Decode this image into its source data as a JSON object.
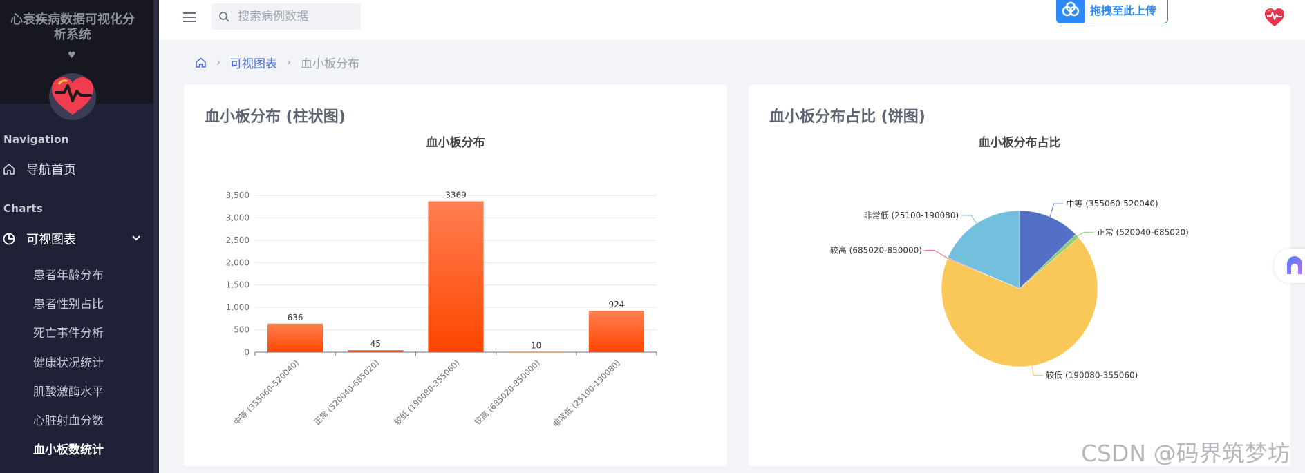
{
  "app": {
    "title": "心衰疾病数据可视化分析系统",
    "heart_glyph": "♥"
  },
  "topbar": {
    "search_placeholder": "搜索病例数据",
    "upload_label": "拖拽至此上传"
  },
  "sidebar": {
    "sections": [
      {
        "heading": "Navigation"
      },
      {
        "heading": "Charts"
      }
    ],
    "home_label": "导航首页",
    "charts_label": "可视图表",
    "sub_items": [
      "患者年龄分布",
      "患者性别占比",
      "死亡事件分析",
      "健康状况统计",
      "肌酸激酶水平",
      "心脏射血分数",
      "血小板数统计"
    ]
  },
  "breadcrumb": {
    "link": "可视图表",
    "current": "血小板分布"
  },
  "cards": {
    "bar_title": "血小板分布 (柱状图)",
    "pie_title": "血小板分布占比 (饼图)"
  },
  "chart_data": [
    {
      "type": "bar",
      "title": "血小板分布",
      "categories": [
        "中等 (355060-520040)",
        "正常 (520040-685020)",
        "较低 (190080-355060)",
        "较高 (685020-850000)",
        "非常低 (25100-190080)"
      ],
      "values": [
        636,
        45,
        3369,
        10,
        924
      ],
      "ylim": [
        0,
        3500
      ],
      "yticks": [
        "0",
        "500",
        "1,000",
        "1,500",
        "2,000",
        "2,500",
        "3,000",
        "3,500"
      ],
      "grid": true,
      "colors": {
        "bar_top": "#ff7f50",
        "bar_bottom": "#ff4500"
      }
    },
    {
      "type": "pie",
      "title": "血小板分布占比",
      "labels": [
        "中等 (355060-520040)",
        "正常 (520040-685020)",
        "较低 (190080-355060)",
        "较高 (685020-850000)",
        "非常低 (25100-190080)"
      ],
      "values": [
        636,
        45,
        3369,
        10,
        924
      ],
      "colors": [
        "#5470c6",
        "#91cc75",
        "#fac858",
        "#ee6666",
        "#73c0de"
      ]
    }
  ],
  "watermark": "CSDN @码界筑梦坊",
  "icons": {
    "menu": "hamburger-icon",
    "search": "search-icon",
    "upload": "cloud-upload-icon",
    "avatar": "heart-pulse-icon",
    "home": "home-icon",
    "charts": "pie-chart-icon",
    "chevron": "chevron-down-icon",
    "assistant": "assistant-icon"
  }
}
